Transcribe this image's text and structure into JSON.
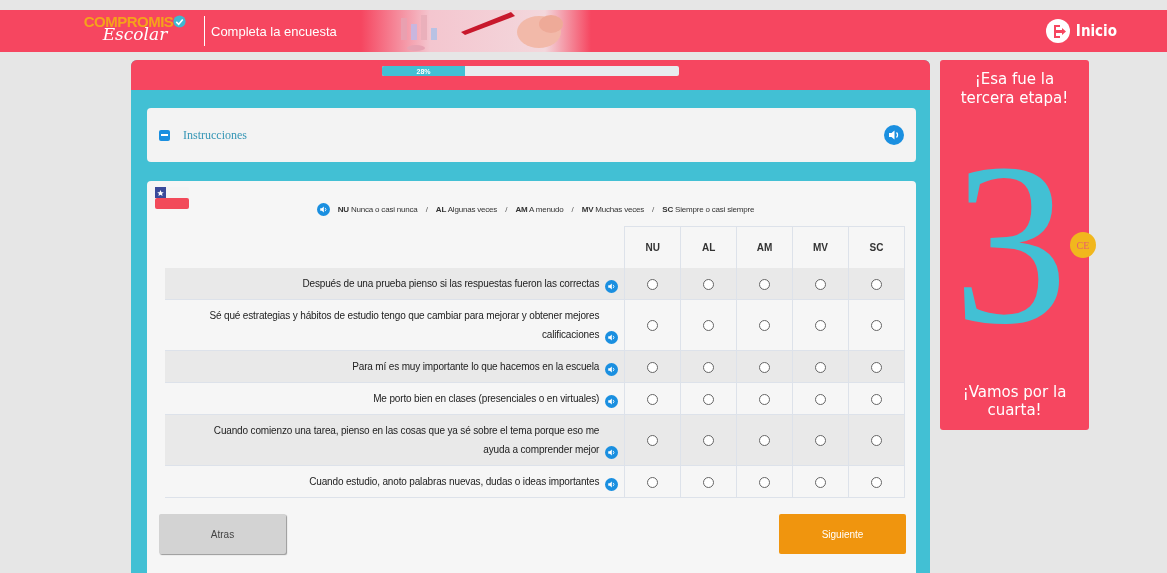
{
  "header": {
    "logo_top": "COMPROMIS",
    "logo_bottom": "Escolar",
    "title": "Completa la encuesta",
    "home_label": "Inicio"
  },
  "progress": {
    "label": "28%",
    "level": 0.28
  },
  "instructions": {
    "label": "Instrucciones",
    "expanded": true
  },
  "legend": [
    {
      "code": "NU",
      "label": "Nunca o casi nunca"
    },
    {
      "code": "AL",
      "label": "Algunas veces"
    },
    {
      "code": "AM",
      "label": "A menudo"
    },
    {
      "code": "MV",
      "label": "Muchas veces"
    },
    {
      "code": "SC",
      "label": "Siempre o casi siempre"
    }
  ],
  "legend_separator": "/",
  "columns": [
    "NU",
    "AL",
    "AM",
    "MV",
    "SC"
  ],
  "questions": [
    {
      "text": "Después de una prueba pienso si las respuestas fueron las correctas",
      "options": [
        {
          "selected": false
        },
        {
          "selected": false
        },
        {
          "selected": false
        },
        {
          "selected": false
        },
        {
          "selected": false
        }
      ]
    },
    {
      "text": "Sé qué estrategias y hábitos de estudio tengo que cambiar para mejorar y obtener mejores calificaciones",
      "options": [
        {
          "selected": false
        },
        {
          "selected": false
        },
        {
          "selected": false
        },
        {
          "selected": false
        },
        {
          "selected": false
        }
      ]
    },
    {
      "text": "Para mí es muy importante lo que hacemos en la escuela",
      "options": [
        {
          "selected": false
        },
        {
          "selected": false
        },
        {
          "selected": false
        },
        {
          "selected": false
        },
        {
          "selected": false
        }
      ]
    },
    {
      "text": "Me porto bien en clases (presenciales o en virtuales)",
      "options": [
        {
          "selected": false
        },
        {
          "selected": false
        },
        {
          "selected": false
        },
        {
          "selected": false
        },
        {
          "selected": false
        }
      ]
    },
    {
      "text": "Cuando comienzo una tarea, pienso en las cosas que ya sé sobre el tema porque eso me ayuda a comprender mejor",
      "options": [
        {
          "selected": false
        },
        {
          "selected": false
        },
        {
          "selected": false
        },
        {
          "selected": false
        },
        {
          "selected": false
        }
      ]
    },
    {
      "text": "Cuando estudio, anoto palabras nuevas, dudas o ideas importantes",
      "options": [
        {
          "selected": false
        },
        {
          "selected": false
        },
        {
          "selected": false
        },
        {
          "selected": false
        },
        {
          "selected": false
        }
      ]
    }
  ],
  "buttons": {
    "back": "Atras",
    "next": "Siguiente"
  },
  "stage_card": {
    "top": "¡Esa fue la tercera etapa!",
    "number": "3",
    "medal": "CE",
    "bottom": "¡Vamos por la cuarta!"
  }
}
